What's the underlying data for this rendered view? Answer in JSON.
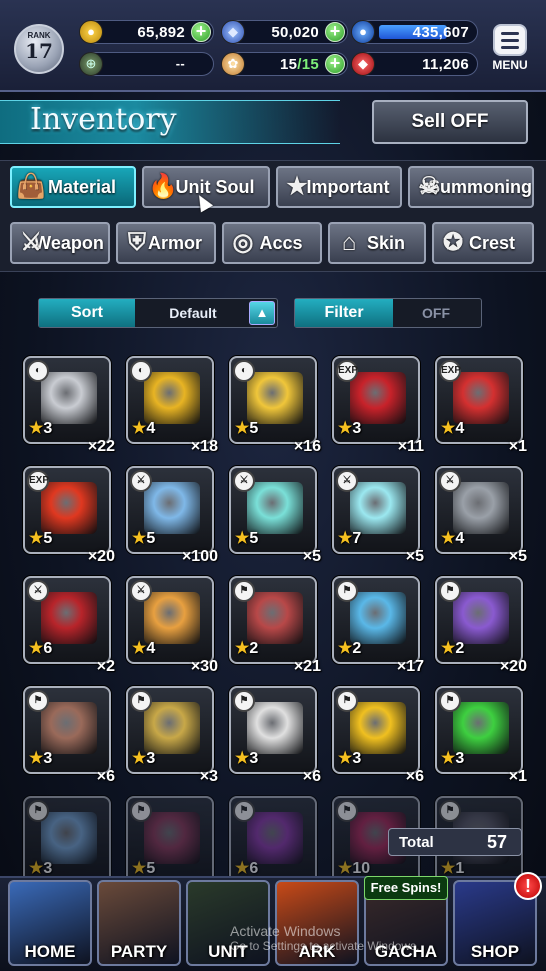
{
  "status": {
    "rank_label": "RANK",
    "rank_value": "17",
    "gold": "65,892",
    "gems": "50,020",
    "exp": "435,607",
    "exp_fill": 0.72,
    "unknown_value": "--",
    "stamina": "15",
    "stamina_max": "/15",
    "rubies": "11,206",
    "menu_label": "MENU"
  },
  "header": {
    "title": "Inventory",
    "sell_label": "Sell OFF"
  },
  "tabs": [
    {
      "label": "Material",
      "icon": "bag-icon",
      "glyph": "👜",
      "active": true
    },
    {
      "label": "Unit Soul",
      "icon": "flame-icon",
      "glyph": "🔥",
      "active": false
    },
    {
      "label": "Important",
      "icon": "star-icon",
      "glyph": "★",
      "active": false
    },
    {
      "label": "Summoning",
      "icon": "skull-icon",
      "glyph": "☠",
      "active": false
    },
    {
      "label": "Weapon",
      "icon": "sword-icon",
      "glyph": "⚔",
      "active": false
    },
    {
      "label": "Armor",
      "icon": "armor-icon",
      "glyph": "⛨",
      "active": false
    },
    {
      "label": "Accs",
      "icon": "necklace-icon",
      "glyph": "◎",
      "active": false
    },
    {
      "label": "Skin",
      "icon": "hanger-icon",
      "glyph": "⌂",
      "active": false
    },
    {
      "label": "Crest",
      "icon": "crest-icon",
      "glyph": "✪",
      "active": false
    }
  ],
  "sort": {
    "label": "Sort",
    "value": "Default"
  },
  "filter": {
    "label": "Filter",
    "value": "OFF"
  },
  "items": [
    {
      "stars": "3",
      "qty": "×22",
      "badge": "◐",
      "art": "silver-ingots",
      "color": "#c9ccd2"
    },
    {
      "stars": "4",
      "qty": "×18",
      "badge": "◐",
      "art": "gold-ingots",
      "color": "#e8b423"
    },
    {
      "stars": "5",
      "qty": "×16",
      "badge": "◐",
      "art": "gold-pile",
      "color": "#f0c63a"
    },
    {
      "stars": "3",
      "qty": "×11",
      "badge": "EXP",
      "art": "red-potion",
      "color": "#c8222a"
    },
    {
      "stars": "4",
      "qty": "×1",
      "badge": "EXP",
      "art": "red-potion-large",
      "color": "#d43030"
    },
    {
      "stars": "5",
      "qty": "×20",
      "badge": "EXP",
      "art": "crimson-flask",
      "color": "#e03820"
    },
    {
      "stars": "5",
      "qty": "×100",
      "badge": "⚔",
      "art": "spirit-orb",
      "color": "#7fb8e8"
    },
    {
      "stars": "5",
      "qty": "×5",
      "badge": "⚔",
      "art": "rainbow-crystal",
      "color": "#7ae0d8"
    },
    {
      "stars": "7",
      "qty": "×5",
      "badge": "⚔",
      "art": "prism-star",
      "color": "#9be8f0"
    },
    {
      "stars": "4",
      "qty": "×5",
      "badge": "⚔",
      "art": "steel-slab",
      "color": "#9aa0a8"
    },
    {
      "stars": "6",
      "qty": "×2",
      "badge": "⚔",
      "art": "red-ore",
      "color": "#b8242a"
    },
    {
      "stars": "4",
      "qty": "×30",
      "badge": "⚔",
      "art": "amber-flask",
      "color": "#e8a040"
    },
    {
      "stars": "2",
      "qty": "×21",
      "badge": "⚑",
      "art": "raw-meat",
      "color": "#b84848"
    },
    {
      "stars": "2",
      "qty": "×17",
      "badge": "⚑",
      "art": "blue-potion",
      "color": "#5ab8e8"
    },
    {
      "stars": "2",
      "qty": "×20",
      "badge": "⚑",
      "art": "amethyst",
      "color": "#8a5ad0"
    },
    {
      "stars": "3",
      "qty": "×6",
      "badge": "⚑",
      "art": "horn",
      "color": "#9a6a5a"
    },
    {
      "stars": "3",
      "qty": "×3",
      "badge": "⚑",
      "art": "gold-ore",
      "color": "#c8a848"
    },
    {
      "stars": "3",
      "qty": "×6",
      "badge": "⚑",
      "art": "wrapped-meat",
      "color": "#e0e0e0"
    },
    {
      "stars": "3",
      "qty": "×6",
      "badge": "⚑",
      "art": "golden-apple",
      "color": "#f0c020"
    },
    {
      "stars": "3",
      "qty": "×1",
      "badge": "⚑",
      "art": "green-potion",
      "color": "#3ed040"
    },
    {
      "stars": "3",
      "qty": "",
      "badge": "⚑",
      "art": "bone",
      "color": "#7aa8d8"
    },
    {
      "stars": "5",
      "qty": "",
      "badge": "⚑",
      "art": "orb",
      "color": "#8a3a5a"
    },
    {
      "stars": "6",
      "qty": "",
      "badge": "⚑",
      "art": "purple-orb",
      "color": "#8a3aa8"
    },
    {
      "stars": "10",
      "qty": "",
      "badge": "⚑",
      "art": "dark-orb",
      "color": "#a82a5a"
    },
    {
      "stars": "1",
      "qty": "",
      "badge": "⚑",
      "art": "gem",
      "color": "#5a5a6a"
    }
  ],
  "total": {
    "label": "Total",
    "value": "57"
  },
  "nav": [
    {
      "label": "HOME",
      "color": "#3a6ab8"
    },
    {
      "label": "PARTY",
      "color": "#6a4a3a"
    },
    {
      "label": "UNIT",
      "color": "#2a3a2a"
    },
    {
      "label": "ARK",
      "color": "#c84a18"
    },
    {
      "label": "GACHA",
      "color": "#3a2a2a"
    },
    {
      "label": "SHOP",
      "color": "#2a3a8a"
    }
  ],
  "gacha_badge": "Free Spins!",
  "shop_alert": "!",
  "watermark_line1": "Activate Windows",
  "watermark_line2": "Go to Settings to activate Windows."
}
